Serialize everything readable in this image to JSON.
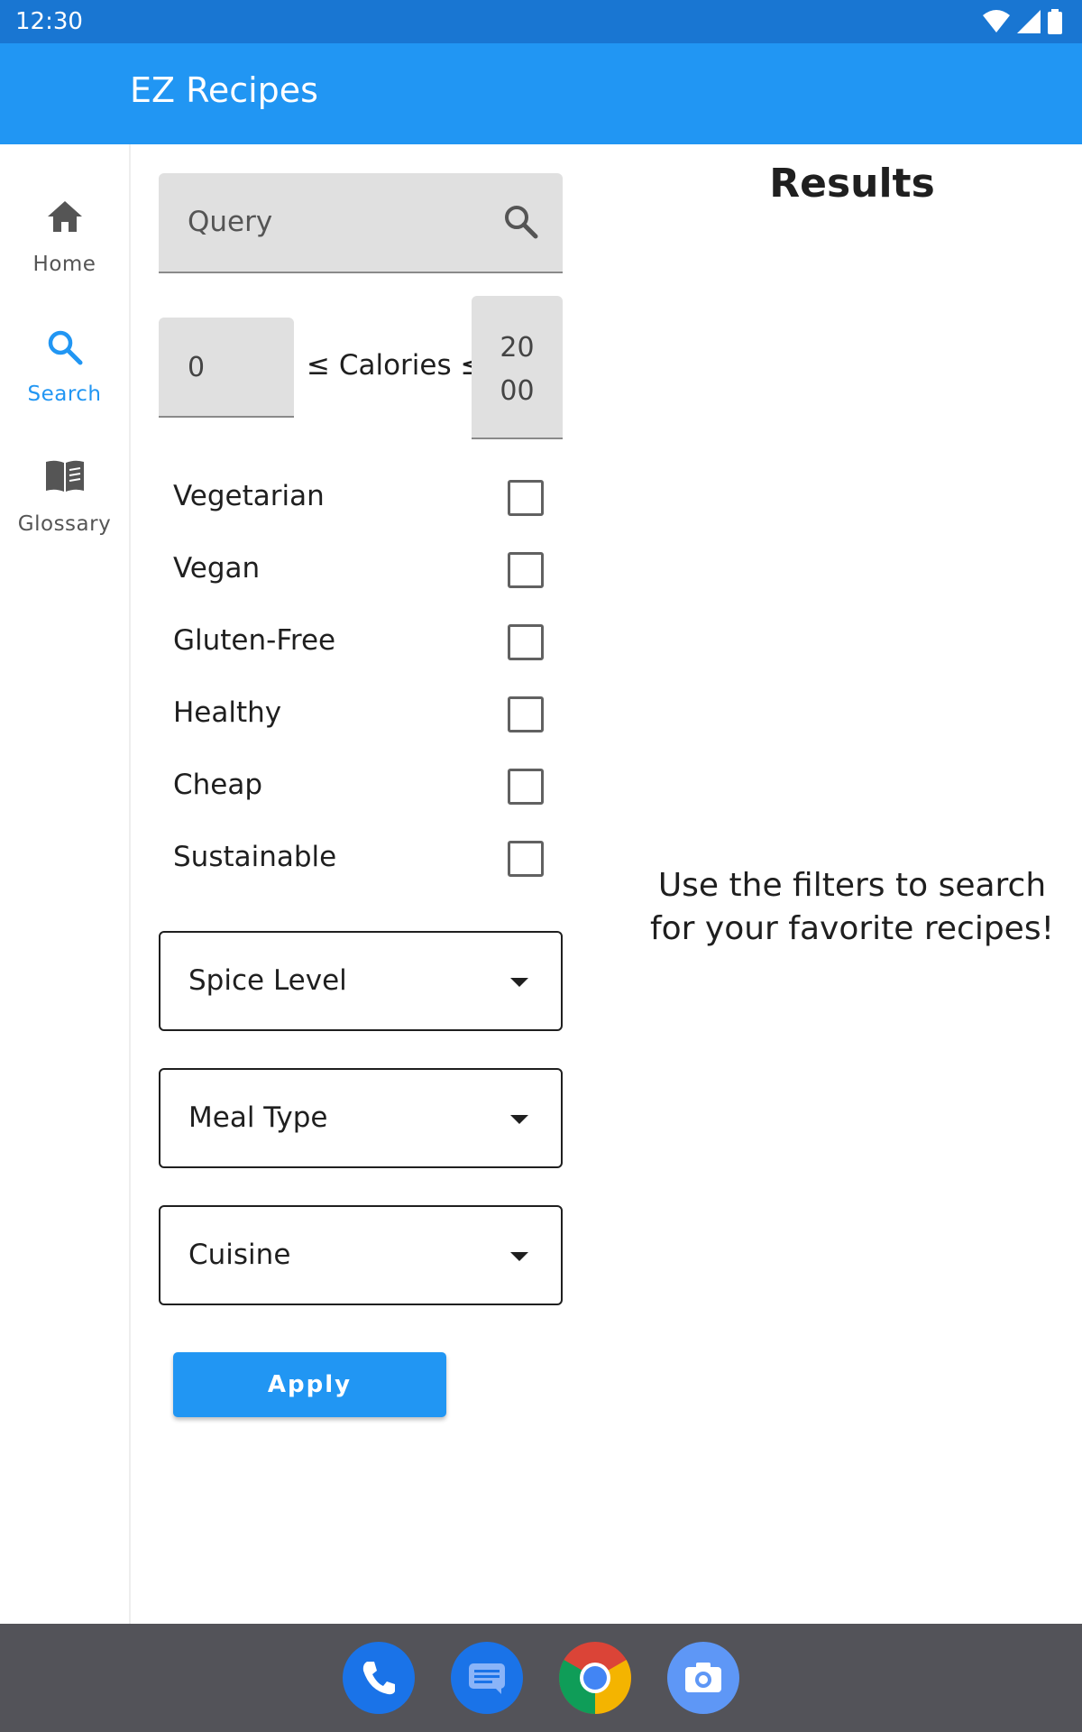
{
  "status_bar": {
    "time": "12:30"
  },
  "app_bar": {
    "title": "EZ Recipes"
  },
  "nav_rail": {
    "items": [
      {
        "label": "Home",
        "icon": "home-icon",
        "active": false
      },
      {
        "label": "Search",
        "icon": "search-icon",
        "active": true
      },
      {
        "label": "Glossary",
        "icon": "book-icon",
        "active": false
      }
    ]
  },
  "filters": {
    "query_placeholder": "Query",
    "calories": {
      "min": "0",
      "label": "≤ Calories ≤",
      "max": "2000"
    },
    "checkboxes": [
      {
        "label": "Vegetarian",
        "checked": false
      },
      {
        "label": "Vegan",
        "checked": false
      },
      {
        "label": "Gluten-Free",
        "checked": false
      },
      {
        "label": "Healthy",
        "checked": false
      },
      {
        "label": "Cheap",
        "checked": false
      },
      {
        "label": "Sustainable",
        "checked": false
      }
    ],
    "dropdowns": [
      "Spice Level",
      "Meal Type",
      "Cuisine"
    ],
    "apply_label": "Apply"
  },
  "results": {
    "title": "Results",
    "empty_message": "Use the filters to search for your favorite recipes!"
  },
  "dock": {
    "apps": [
      "phone-icon",
      "messages-icon",
      "chrome-icon",
      "camera-icon"
    ]
  },
  "colors": {
    "status_bar": "#1976d2",
    "app_bar": "#2196f3",
    "accent": "#2196f3",
    "dock": "#535359"
  }
}
